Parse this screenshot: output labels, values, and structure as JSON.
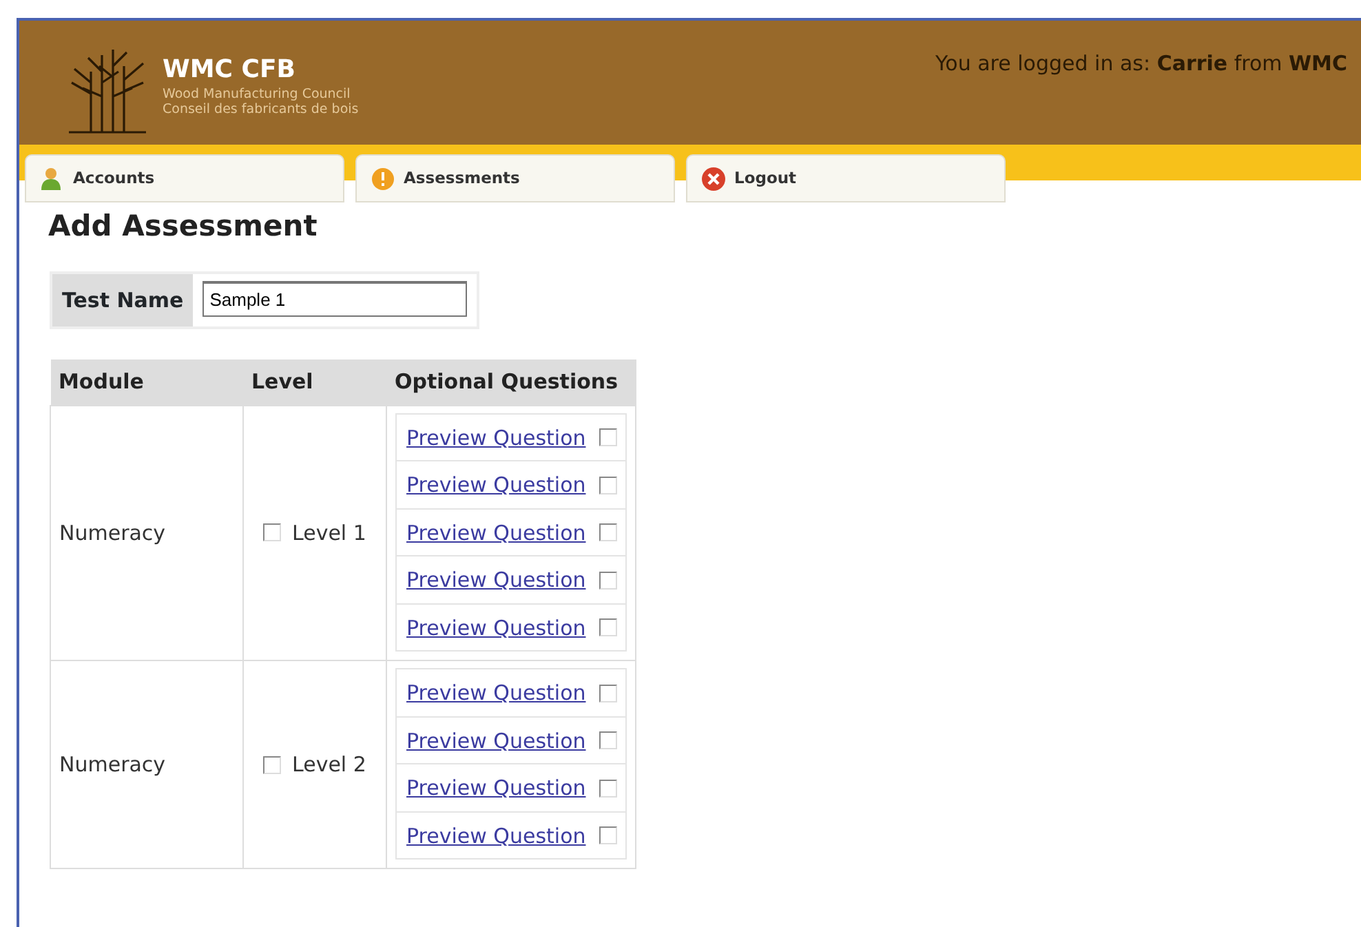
{
  "header": {
    "logo_title": "WMC CFB",
    "logo_subtitle_1": "Wood Manufacturing Council",
    "logo_subtitle_2": "Conseil des fabricants de bois",
    "login_text": "You are logged in as: **Carrie** from **WMC**"
  },
  "tabs": [
    {
      "label": "Accounts",
      "kind": "person"
    },
    {
      "label": "Assessments",
      "kind": "warning"
    },
    {
      "label": "Logout",
      "kind": "close"
    }
  ],
  "page_title": "Add Assessment",
  "test_name": {
    "label": "Test Name",
    "value": "Sample 1"
  },
  "table": {
    "columns": [
      "Module",
      "Level",
      "Optional Questions"
    ],
    "rows": [
      {
        "module": "Numeracy",
        "level": "Level 1",
        "checked": false,
        "questions": [
          {
            "label": "Preview Question",
            "checked": false
          },
          {
            "label": "Preview Question",
            "checked": false
          },
          {
            "label": "Preview Question",
            "checked": false
          },
          {
            "label": "Preview Question",
            "checked": false
          },
          {
            "label": "Preview Question",
            "checked": false
          }
        ]
      },
      {
        "module": "Numeracy",
        "level": "Level 2",
        "checked": false,
        "questions": [
          {
            "label": "Preview Question",
            "checked": false
          },
          {
            "label": "Preview Question",
            "checked": false
          },
          {
            "label": "Preview Question",
            "checked": false
          },
          {
            "label": "Preview Question",
            "checked": false
          }
        ]
      }
    ]
  }
}
